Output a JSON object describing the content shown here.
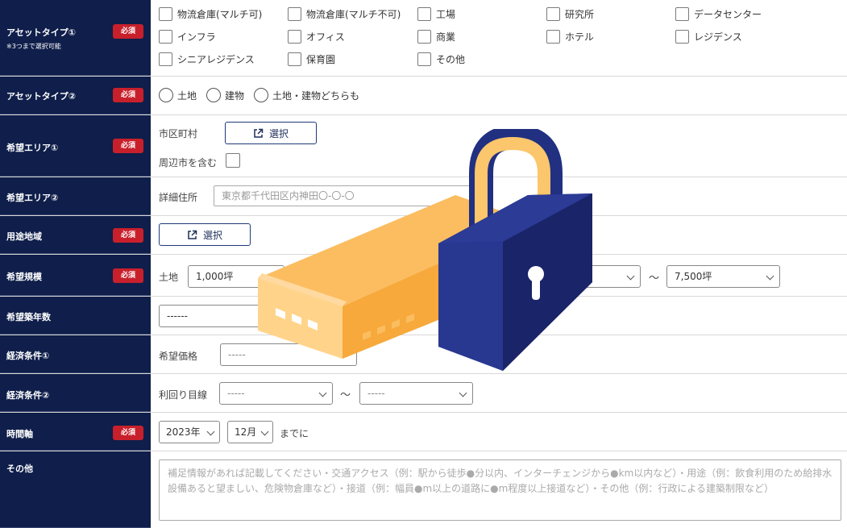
{
  "required_badge": "必須",
  "asset_type_1": {
    "label": "アセットタイプ①",
    "note": "※3つまで選択可能",
    "options": [
      "物流倉庫(マルチ可)",
      "物流倉庫(マルチ不可)",
      "工場",
      "研究所",
      "データセンター",
      "インフラ",
      "オフィス",
      "商業",
      "ホテル",
      "レジデンス",
      "シニアレジデンス",
      "保育園",
      "その他"
    ]
  },
  "asset_type_2": {
    "label": "アセットタイプ②",
    "options": [
      "土地",
      "建物",
      "土地・建物どちらも"
    ]
  },
  "area_1": {
    "label": "希望エリア①",
    "city_label": "市区町村",
    "select_button": "選択",
    "nearby_label": "周辺市を含む"
  },
  "area_2": {
    "label": "希望エリア②",
    "address_label": "詳細住所",
    "address_placeholder": "東京都千代田区内神田〇-〇-〇"
  },
  "zoning": {
    "label": "用途地域",
    "select_button": "選択"
  },
  "scale": {
    "label": "希望規模",
    "land_label": "土地",
    "land_value": "1,000坪",
    "tilde": "〜",
    "max_value": "7,500坪"
  },
  "building_age": {
    "label": "希望築年数",
    "value": "------"
  },
  "econ_1": {
    "label": "経済条件①",
    "price_label": "希望価格",
    "price_value": "-----"
  },
  "econ_2": {
    "label": "経済条件②",
    "yield_label": "利回り目線",
    "from_value": "-----",
    "tilde": "〜",
    "to_value": "-----"
  },
  "timeline": {
    "label": "時間軸",
    "year": "2023年",
    "month": "12月",
    "suffix": "までに"
  },
  "other": {
    "label": "その他",
    "placeholder": "補足情報があれば記載してください・交通アクセス（例：駅から徒歩●分以内、インターチェンジから●km以内など）・用途（例：飲食利用のため給排水設備あると望ましい、危険物倉庫など）・接道（例：幅員●m以上の道路に●m程度以上接道など）・その他（例：行政による建築制限など）"
  },
  "colors": {
    "label_bg": "#0f1e4a",
    "required_red": "#c8202b",
    "lock_navy": "#243384",
    "building_orange": "#f9b95c"
  }
}
